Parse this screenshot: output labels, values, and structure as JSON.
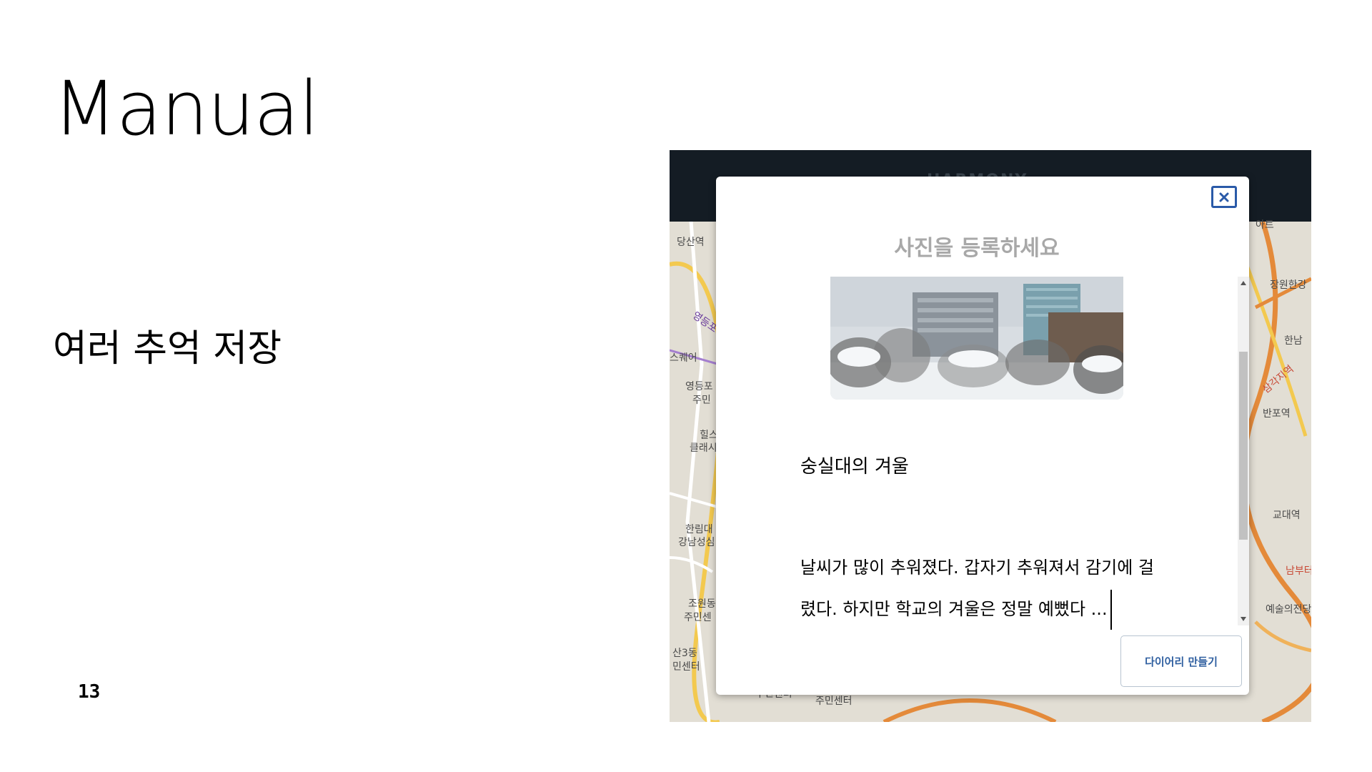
{
  "slide": {
    "title": "Manual",
    "subtitle": "여러 추억 저장",
    "page_number": "13"
  },
  "app": {
    "header_logo": "HARMONY",
    "map_labels": [
      "당산역",
      "영등포",
      "스퀘어",
      "영등포",
      "주민",
      "힐스",
      "클래시",
      "한림대",
      "강남성심",
      "조원동",
      "주민센",
      "산3동",
      "민센터",
      "주민센터",
      "주민센터",
      "아트",
      "장원한강",
      "한남",
      "삼각지역",
      "반포역",
      "교대역",
      "남부터미널",
      "예술의전당"
    ]
  },
  "modal": {
    "heading": "사진을 등록하세요",
    "entry_title": "숭실대의 겨울",
    "entry_body": "날씨가 많이 추워졌다. 갑자기 추워져서 감기에 걸렸다. 하지만 학교의 겨울은 정말 예뻤다 ...",
    "create_button": "다이어리 만들기"
  },
  "colors": {
    "close_border": "#2a5aa8",
    "heading_gray": "#a8a8a8",
    "button_text": "#2f5fa0",
    "header_dark": "#141c24"
  }
}
